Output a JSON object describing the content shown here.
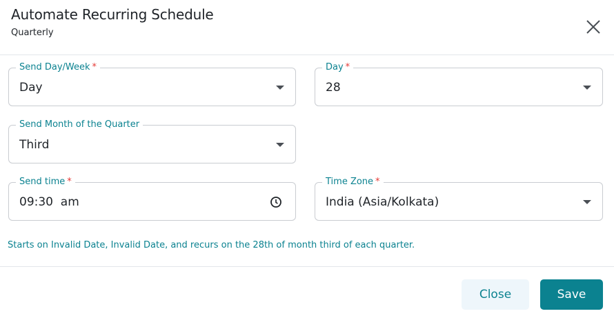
{
  "dialog": {
    "title": "Automate Recurring Schedule",
    "subtitle": "Quarterly"
  },
  "fields": {
    "send_day_week": {
      "label": "Send Day/Week",
      "required_mark": "*",
      "value": "Day"
    },
    "day": {
      "label": "Day",
      "required_mark": "*",
      "value": "28"
    },
    "send_month": {
      "label": "Send Month of the Quarter",
      "value": "Third"
    },
    "send_time": {
      "label": "Send time",
      "required_mark": "*",
      "value": "09:30  am"
    },
    "time_zone": {
      "label": "Time Zone",
      "required_mark": "*",
      "value": "India (Asia/Kolkata)"
    }
  },
  "summary": "Starts on Invalid Date, Invalid Date, and recurs on the 28th of month third of each quarter.",
  "buttons": {
    "close": "Close",
    "save": "Save"
  },
  "colors": {
    "accent": "#0b8290",
    "required": "#e53935",
    "border": "#c9ccd1",
    "close_button_bg": "#eef6fb"
  },
  "icons": {
    "dialog_close": "close-icon",
    "dropdown": "chevron-down-icon",
    "time": "clock-icon"
  }
}
